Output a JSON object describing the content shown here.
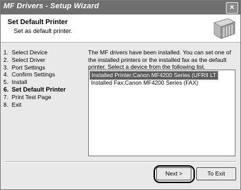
{
  "window": {
    "title": "MF Drivers - Setup Wizard",
    "close_glyph": "×"
  },
  "header": {
    "title": "Set Default Printer",
    "subtitle": "Set as default printer.",
    "icon": "printer-box-icon"
  },
  "steps": [
    {
      "num": "1.",
      "label": "Select Device",
      "active": false
    },
    {
      "num": "2.",
      "label": "Select Driver",
      "active": false
    },
    {
      "num": "3.",
      "label": "Port Settings",
      "active": false
    },
    {
      "num": "4.",
      "label": "Confirm Settings",
      "active": false
    },
    {
      "num": "5.",
      "label": "Install",
      "active": false
    },
    {
      "num": "6.",
      "label": "Set Default Printer",
      "active": true
    },
    {
      "num": "7.",
      "label": "Print Test Page",
      "active": false
    },
    {
      "num": "8.",
      "label": "Exit",
      "active": false
    }
  ],
  "main": {
    "description": "The MF drivers have been installed. You can set one of the installed printers or the installed fax as the default printer. Select a device from the following list.",
    "devices": [
      {
        "label": "Installed Printer:Canon MF4200 Series (UFRII LT",
        "selected": true
      },
      {
        "label": "Installed Fax:Canon MF4200 Series (FAX)",
        "selected": false
      }
    ]
  },
  "buttons": {
    "next": "Next >",
    "exit": "To Exit"
  },
  "colors": {
    "titlebar": "#6f6f6f",
    "selection": "#5a5a5a",
    "panel": "#e9e9e9"
  }
}
